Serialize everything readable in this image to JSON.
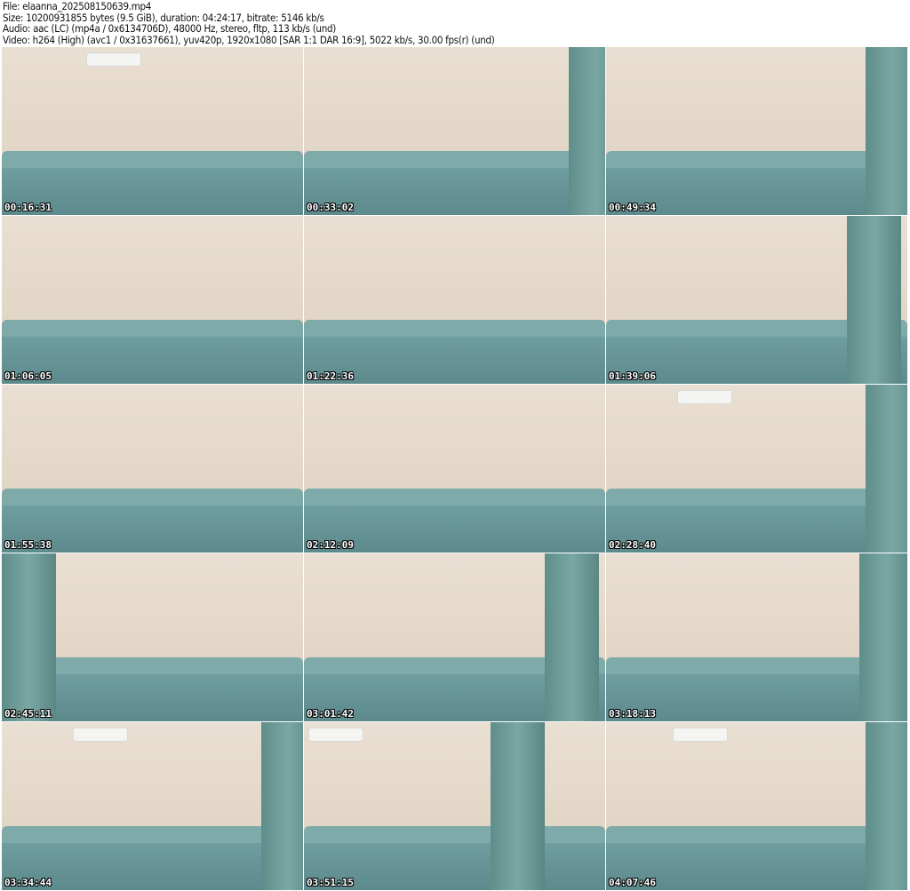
{
  "header": {
    "file": "File: elaanna_202508150639.mp4",
    "size": "Size: 10200931855 bytes (9.5 GiB), duration: 04:24:17, bitrate: 5146 kb/s",
    "audio": "Audio: aac (LC) (mp4a / 0x6134706D), 48000 Hz, stereo, fltp, 113 kb/s (und)",
    "video": "Video: h264 (High) (avc1 / 0x31637661), yuv420p, 1920x1080 [SAR 1:1 DAR 16:9], 5022 kb/s, 30.00 fps(r) (und)"
  },
  "thumbnails": [
    {
      "time": "00:16:31"
    },
    {
      "time": "00:33:02"
    },
    {
      "time": "00:49:34"
    },
    {
      "time": "01:06:05"
    },
    {
      "time": "01:22:36"
    },
    {
      "time": "01:39:06"
    },
    {
      "time": "01:55:38"
    },
    {
      "time": "02:12:09"
    },
    {
      "time": "02:28:40"
    },
    {
      "time": "02:45:11"
    },
    {
      "time": "03:01:42"
    },
    {
      "time": "03:18:13"
    },
    {
      "time": "03:34:44"
    },
    {
      "time": "03:51:15"
    },
    {
      "time": "04:07:46"
    }
  ]
}
